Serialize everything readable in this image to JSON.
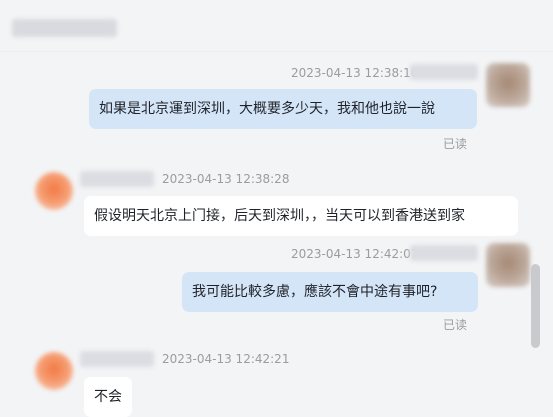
{
  "messages": [
    {
      "side": "right",
      "timestamp": "2023-04-13 12:38:10",
      "text": "如果是北京運到深圳，大概要多少天，我和他也說一說",
      "status": "已读"
    },
    {
      "side": "left",
      "timestamp": "2023-04-13 12:38:28",
      "text": "假设明天北京上门接，后天到深圳，，当天可以到香港送到家"
    },
    {
      "side": "right",
      "timestamp": "2023-04-13 12:42:07",
      "text": "我可能比較多慮，應該不會中途有事吧?",
      "status": "已读"
    },
    {
      "side": "left",
      "timestamp": "2023-04-13 12:42:21",
      "text": "不会"
    }
  ],
  "colors": {
    "background": "#f3f4f6",
    "bubble_self": "#d5e5f8",
    "bubble_other": "#ffffff",
    "meta_text": "#9a9ca2"
  }
}
